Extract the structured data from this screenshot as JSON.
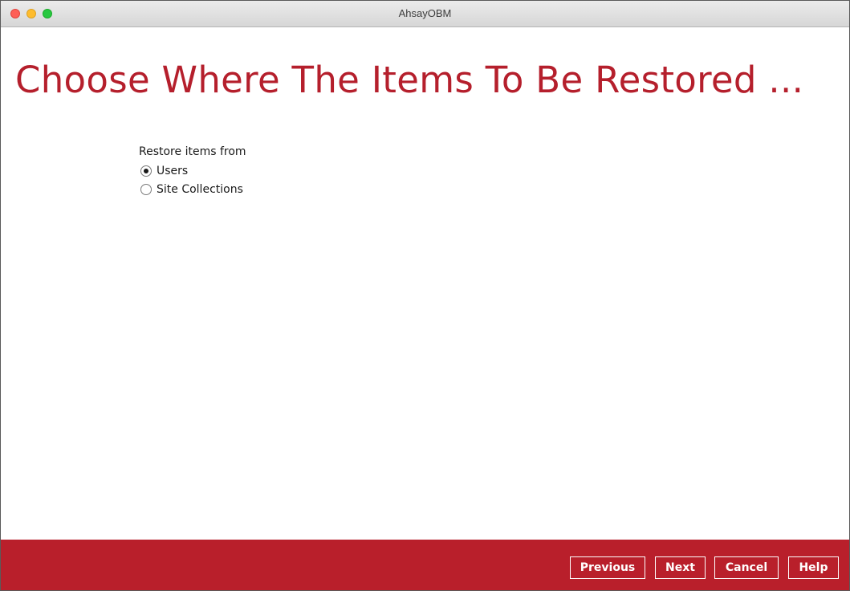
{
  "window": {
    "title": "AhsayOBM"
  },
  "header": {
    "title": "Choose Where The Items To Be Restored ..."
  },
  "restore_source": {
    "label": "Restore items from",
    "options": [
      {
        "label": "Users",
        "selected": true
      },
      {
        "label": "Site Collections",
        "selected": false
      }
    ]
  },
  "footer": {
    "previous_label": "Previous",
    "next_label": "Next",
    "cancel_label": "Cancel",
    "help_label": "Help"
  },
  "colors": {
    "accent": "#b91f2b",
    "title_text": "#b51f2c"
  }
}
